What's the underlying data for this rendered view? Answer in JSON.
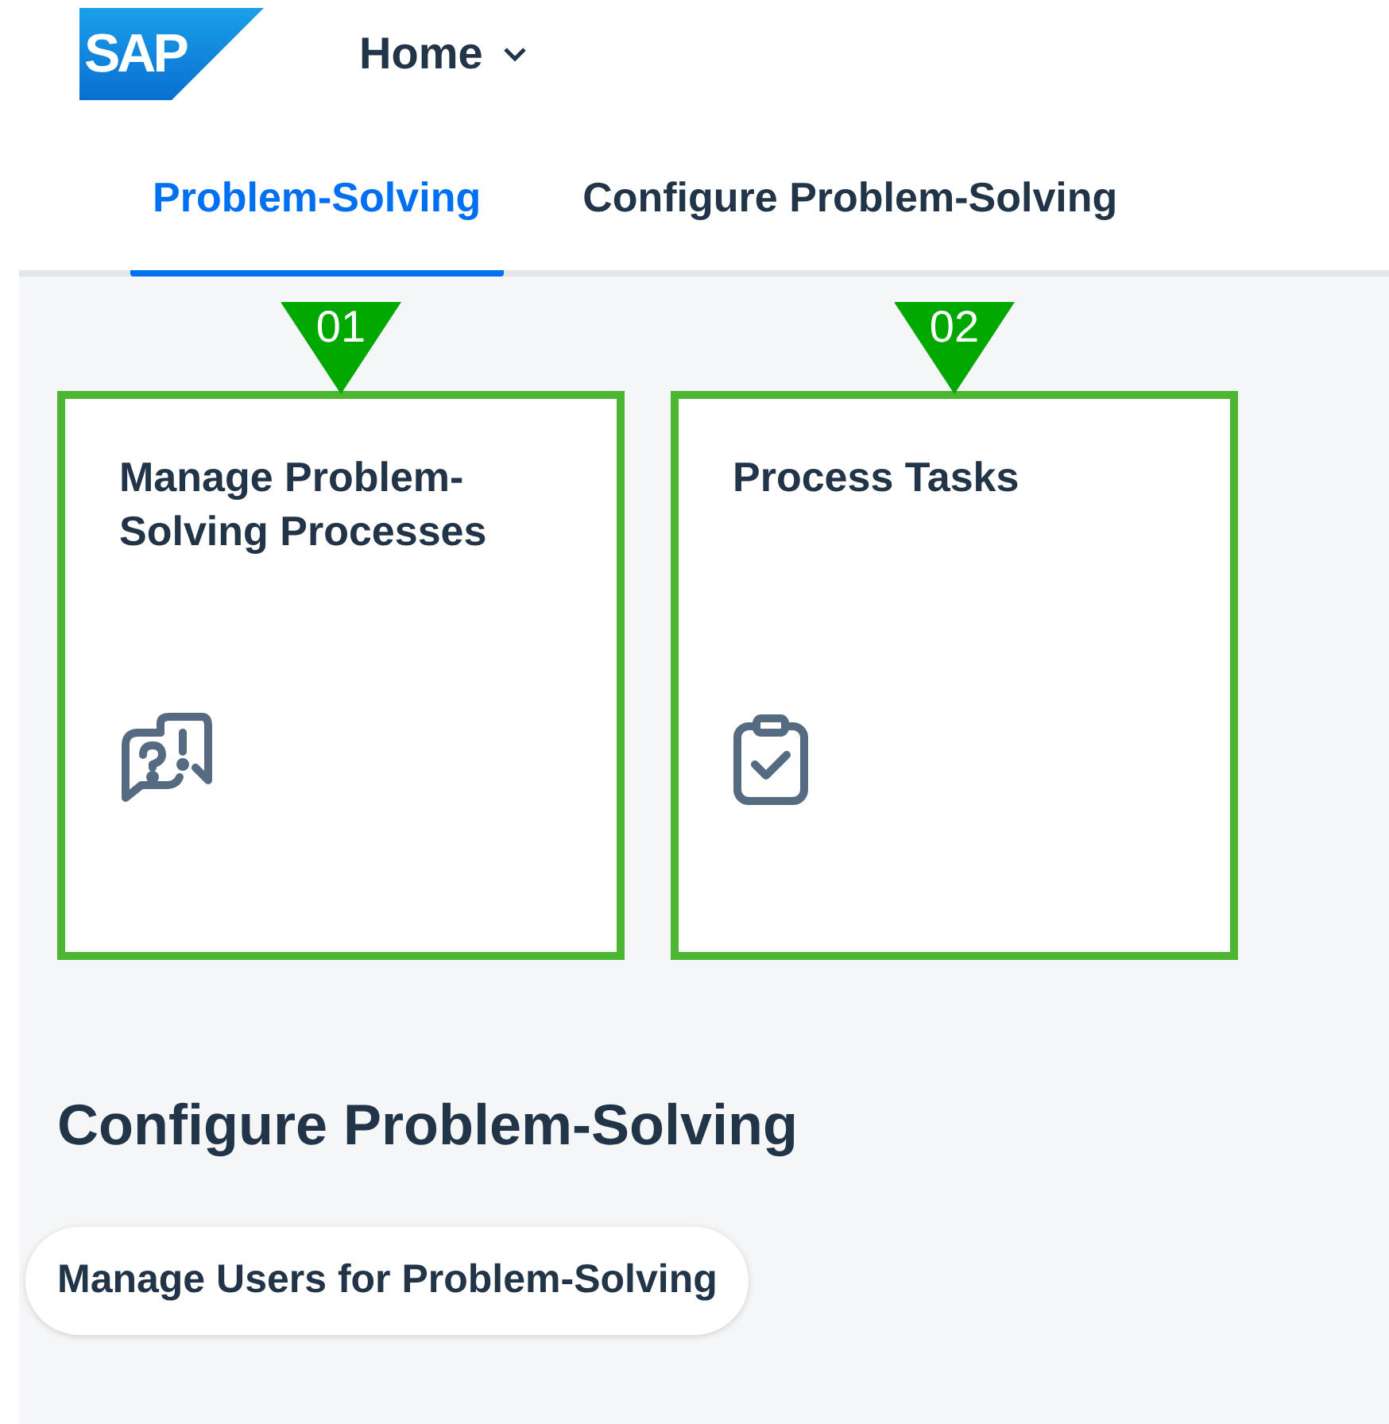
{
  "logo": {
    "text": "SAP"
  },
  "header": {
    "menu": "Home"
  },
  "tabs": [
    {
      "label": "Problem-Solving",
      "selected": true
    },
    {
      "label": "Configure Problem-Solving",
      "selected": false
    }
  ],
  "tiles": [
    {
      "callout": "01",
      "title": "Manage Problem-Solving Processes",
      "kind": "chat",
      "highlighted": true
    },
    {
      "callout": "02",
      "title": "Process Tasks",
      "kind": "clipboard",
      "highlighted": true
    }
  ],
  "section": {
    "title": "Configure Problem-Solving",
    "links": [
      "Manage Users for Problem-Solving"
    ]
  }
}
